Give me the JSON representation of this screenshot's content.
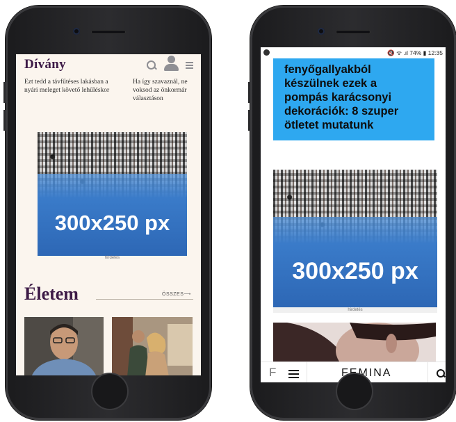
{
  "left_phone": {
    "site": {
      "logo": "Dívány"
    },
    "teasers": [
      "Ezt tedd a távfűtéses lakásban a\nnyári meleget követő lehűléskor",
      "Ha így szavaznál, ne\nvoksod az önkormár\nválasztáson"
    ],
    "ad": {
      "size_label": "300x250 px",
      "label": "hirdetés"
    },
    "section": {
      "title": "Életem",
      "all_link": "ÖSSZES⟶"
    }
  },
  "right_phone": {
    "status_bar": {
      "right": "🔇 ᯤ .ıl 74% ▮ 12:35"
    },
    "article": {
      "title": "fenyőgallyakból\nkészülnek ezek a\npompás karácsonyi\ndekorációk: 8 szuper\nötletet mutatunk",
      "card_color": "#2ea8f0"
    },
    "ad": {
      "size_label": "300x250 px",
      "label": "hirdetés"
    },
    "nav": {
      "f_icon": "F",
      "logo": "FEMINA"
    }
  },
  "colors": {
    "divany_purple": "#3d1a46",
    "ad_blue": "#2d67b5"
  }
}
